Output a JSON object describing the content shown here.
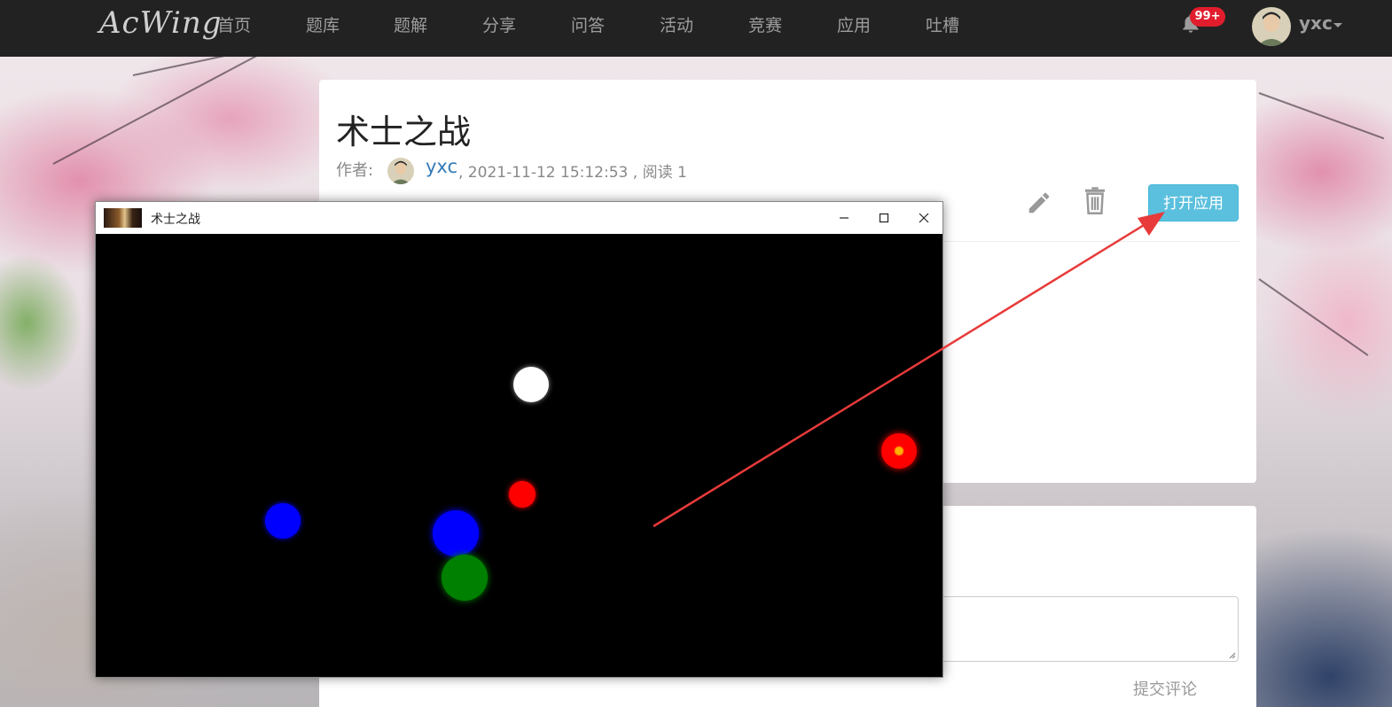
{
  "navbar": {
    "logo": "AcWing",
    "items": [
      "首页",
      "题库",
      "题解",
      "分享",
      "问答",
      "活动",
      "竞赛",
      "应用",
      "吐槽"
    ],
    "notification_badge": "99+",
    "username": "yxc"
  },
  "article": {
    "title": "术士之战",
    "author_label": "作者:",
    "author": "yxc",
    "meta_rest": ", 2021-11-12 15:12:53 , 阅读 1",
    "open_app_button": "打开应用"
  },
  "comments": {
    "submit_label": "提交评论"
  },
  "app_window": {
    "title": "术士之战"
  },
  "colors": {
    "navbar_bg": "#222222",
    "nav_text": "#9d9d9d",
    "link": "#337ab7",
    "info_button": "#5bc0de",
    "badge": "#e11d2d",
    "annotation_arrow": "#e83a3a",
    "player": "#ffffff",
    "red_ball": "#ff0000",
    "blue_ball": "#0000ff",
    "green_ball": "#008000"
  }
}
